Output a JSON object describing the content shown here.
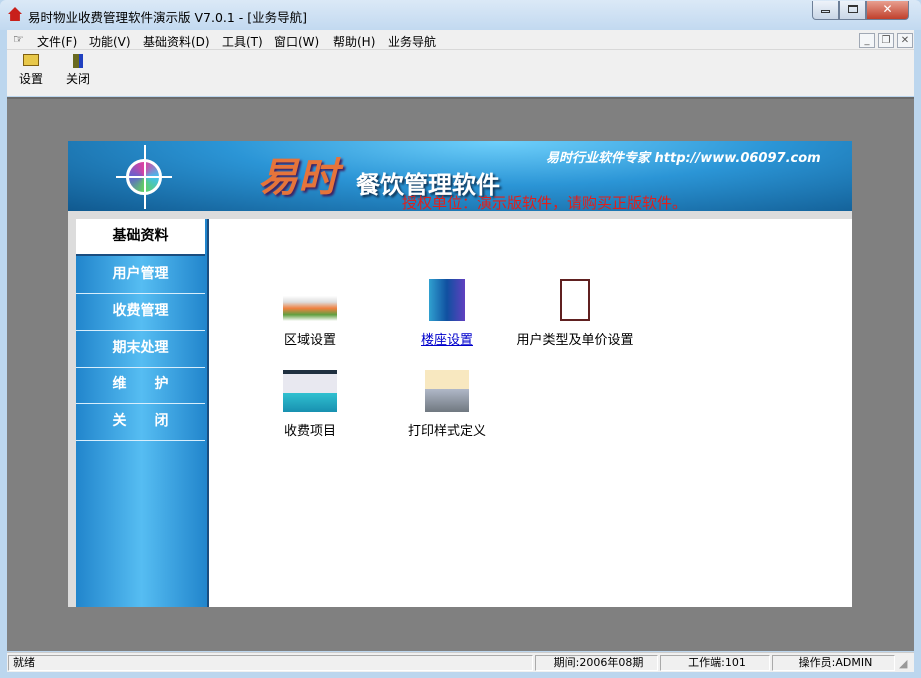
{
  "window": {
    "title": "易时物业收费管理软件演示版 V7.0.1 - [业务导航]"
  },
  "menu": [
    "文件(F)",
    "功能(V)",
    "基础资料(D)",
    "工具(T)",
    "窗口(W)",
    "帮助(H)",
    "业务导航"
  ],
  "toolbar": {
    "settings": "设置",
    "close": "关闭"
  },
  "banner": {
    "brand": "易时",
    "product": "餐饮管理软件",
    "tagline": "易时行业软件专家 http://www.06097.com",
    "license": "授权单位：演示版软件，请购买正版软件。"
  },
  "sidebar": {
    "items": [
      "基础资料",
      "用户管理",
      "收费管理",
      "期末处理",
      "维　　护",
      "关　　闭"
    ],
    "active": 0
  },
  "content": {
    "items": [
      "区域设置",
      "楼座设置",
      "用户类型及单价设置",
      "收费项目",
      "打印样式定义"
    ]
  },
  "status": {
    "ready": "就绪",
    "period": "期间:2006年08期",
    "workstation": "工作端:101",
    "operator": "操作员:ADMIN"
  },
  "colors": {
    "mdi": "#808080",
    "sidebar": "#2185cc",
    "license": "#e0201c",
    "link": "#0000cc"
  }
}
